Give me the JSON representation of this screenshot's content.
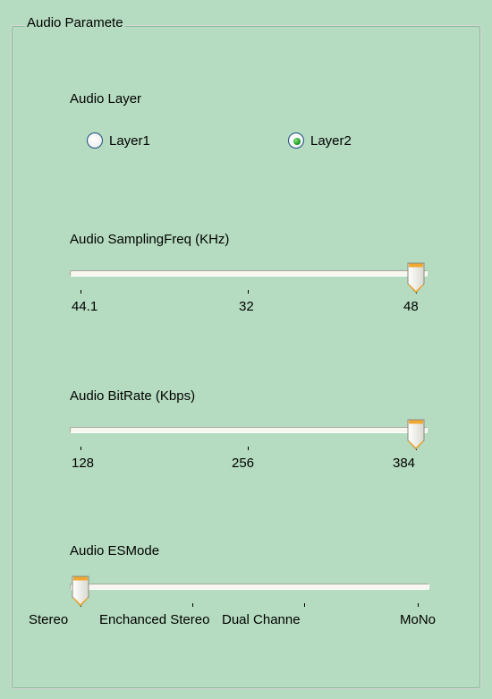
{
  "group": {
    "title": "Audio Paramete"
  },
  "audio_layer": {
    "label": "Audio Layer",
    "options": [
      {
        "label": "Layer1",
        "selected": false
      },
      {
        "label": "Layer2",
        "selected": true
      }
    ]
  },
  "sampling_freq": {
    "label": "Audio SamplingFreq (KHz)",
    "ticks": [
      "44.1",
      "32",
      "48"
    ],
    "selected_index": 2
  },
  "bitrate": {
    "label": "Audio BitRate (Kbps)",
    "ticks": [
      "128",
      "256",
      "384"
    ],
    "selected_index": 2
  },
  "es_mode": {
    "label": "Audio ESMode",
    "ticks": [
      "Stereo",
      "Enchanced Stereo",
      "Dual  Channe",
      "MoNo"
    ],
    "selected_index": 0
  },
  "colors": {
    "panel_bg": "#b5dcc0",
    "radio_selected": "#21a121",
    "thumb_accent": "#f0a830"
  }
}
